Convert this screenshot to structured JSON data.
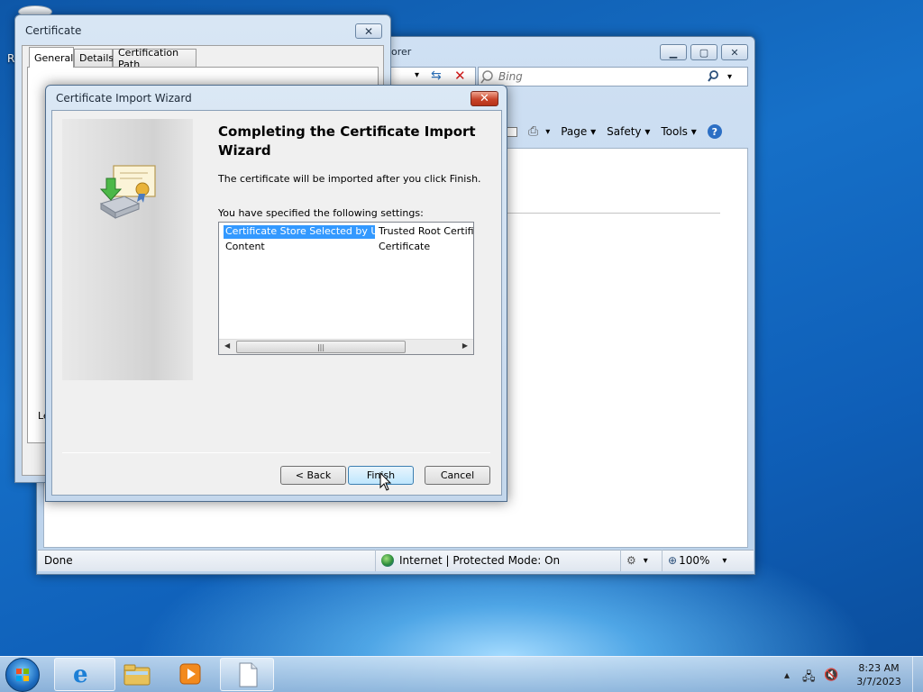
{
  "desktop": {
    "stray_letter": "R"
  },
  "ie": {
    "title_fragment": "orer",
    "search_placeholder": "Bing",
    "cmd": {
      "page": "Page ▾",
      "safety": "Safety ▾",
      "tools": "Tools ▾"
    },
    "status": {
      "done": "Done",
      "zone": "Internet | Protected Mode: On",
      "zoom": "100%"
    }
  },
  "certificate": {
    "title": "Certificate",
    "close": "✕",
    "tabs": [
      "General",
      "Details",
      "Certification Path"
    ],
    "partial_text": "Le"
  },
  "wizard": {
    "title": "Certificate Import Wizard",
    "close": "✕",
    "heading": "Completing the Certificate Import Wizard",
    "text": "The certificate will be imported after you click Finish.",
    "settings_label": "You have specified the following settings:",
    "rows": [
      {
        "name": "Certificate Store Selected by User",
        "value": "Trusted Root Certifica"
      },
      {
        "name": "Content",
        "value": "Certificate"
      }
    ],
    "buttons": {
      "back": "< Back",
      "finish": "Finish",
      "cancel": "Cancel"
    }
  },
  "taskbar": {
    "time": "8:23 AM",
    "date": "3/7/2023"
  },
  "colors": {
    "selection": "#3399ff",
    "close_red": "#c8442a",
    "desktop_blue": "#1670c8"
  }
}
